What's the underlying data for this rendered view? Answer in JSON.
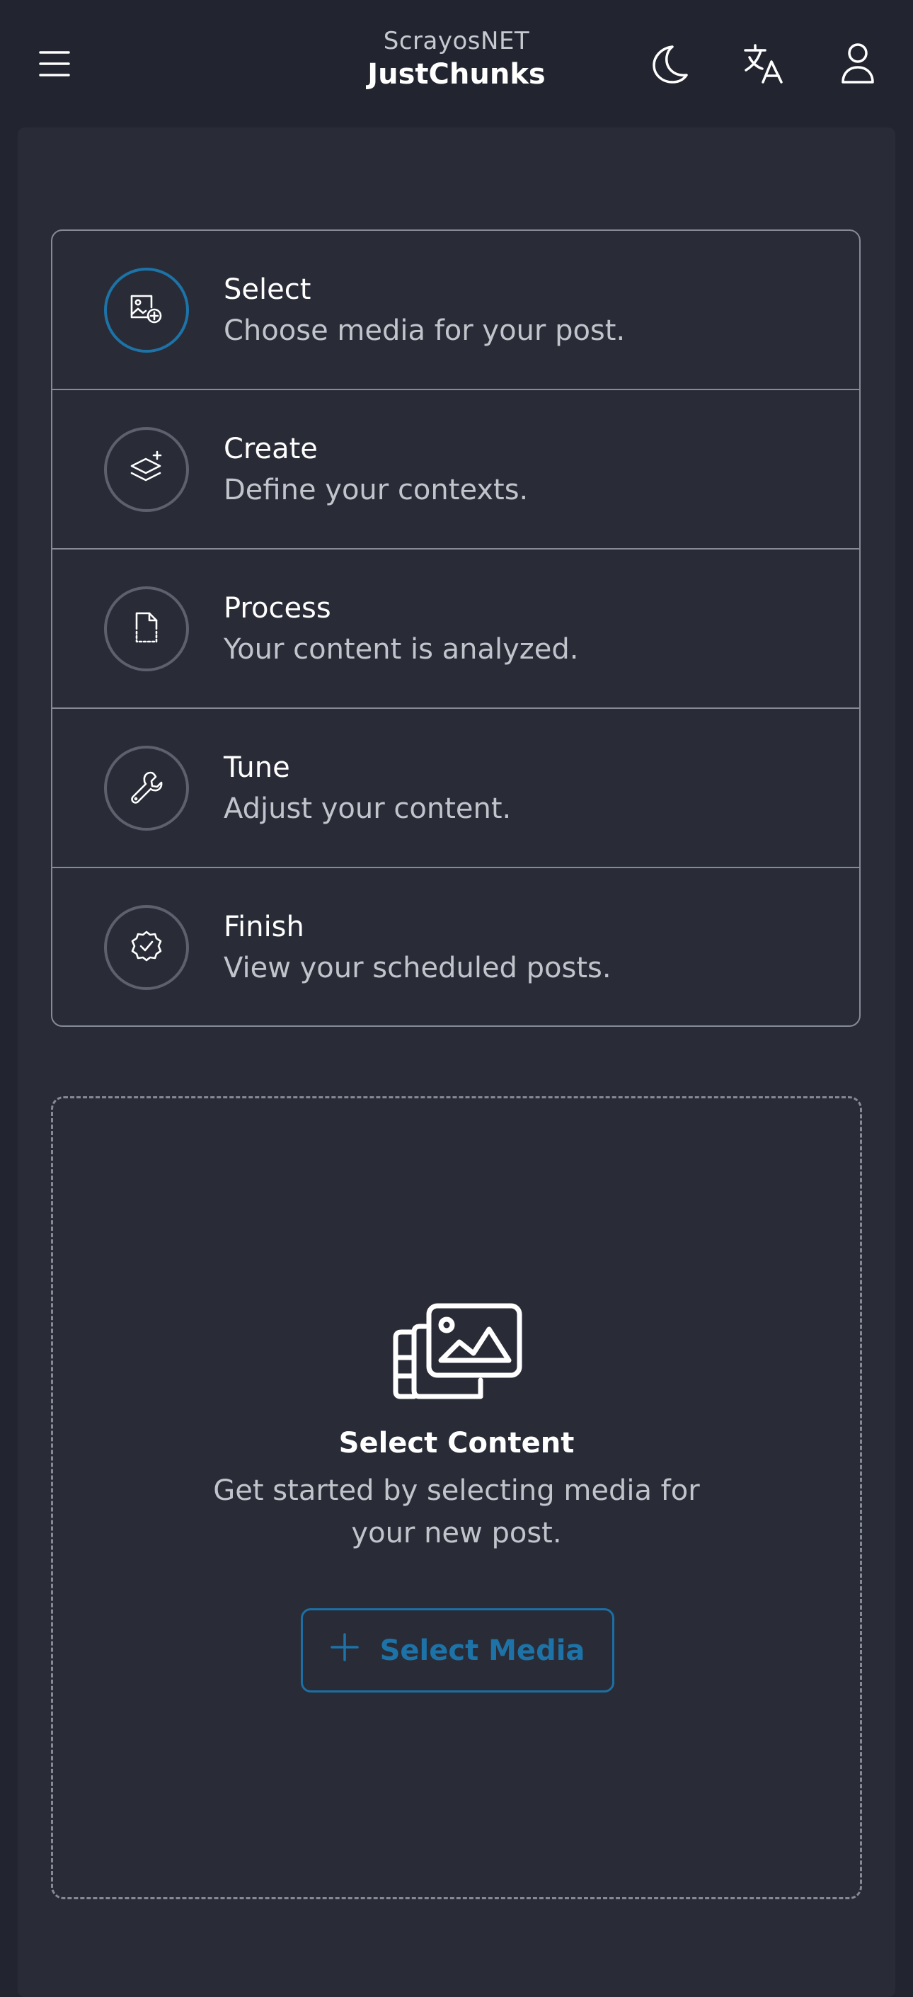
{
  "header": {
    "org_name": "ScrayosNET",
    "app_name": "JustChunks",
    "menu_icon": "hamburger-menu-icon",
    "theme_icon": "moon-icon",
    "language_icon": "translate-icon",
    "account_icon": "user-icon"
  },
  "steps": [
    {
      "title": "Select",
      "description": "Choose media for your post.",
      "icon": "image-add-icon",
      "active": true
    },
    {
      "title": "Create",
      "description": "Define your contexts.",
      "icon": "layers-add-icon",
      "active": false
    },
    {
      "title": "Process",
      "description": "Your content is analyzed.",
      "icon": "document-scan-icon",
      "active": false
    },
    {
      "title": "Tune",
      "description": "Adjust your content.",
      "icon": "wrench-icon",
      "active": false
    },
    {
      "title": "Finish",
      "description": "View your scheduled posts.",
      "icon": "badge-check-icon",
      "active": false
    }
  ],
  "dropzone": {
    "illustration": "media-gallery-icon",
    "title": "Select Content",
    "description": "Get started by selecting media for your new post.",
    "button_label": "Select Media",
    "button_icon": "plus-icon"
  },
  "colors": {
    "background": "#22252f",
    "card": "#292c37",
    "accent": "#1d73a8",
    "border": "#878b97",
    "muted_text": "#c2c4cb"
  }
}
